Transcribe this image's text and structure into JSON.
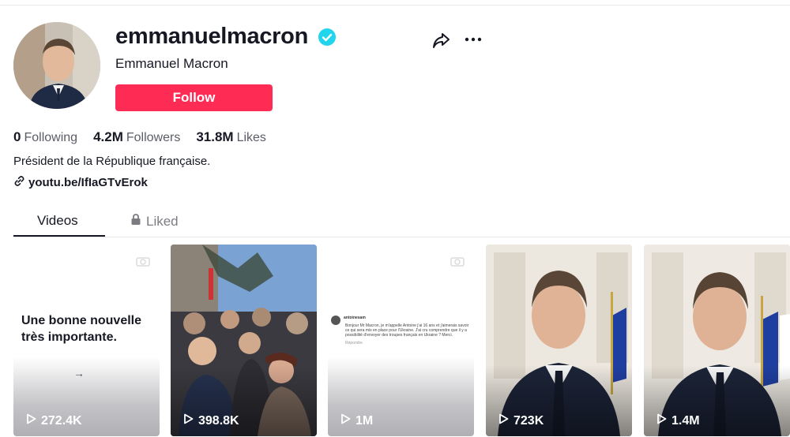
{
  "profile": {
    "username": "emmanuelmacron",
    "nickname": "Emmanuel Macron",
    "follow_label": "Follow",
    "stats": [
      {
        "value": "0",
        "label": "Following"
      },
      {
        "value": "4.2M",
        "label": "Followers"
      },
      {
        "value": "31.8M",
        "label": "Likes"
      }
    ],
    "bio": "Président de la République française.",
    "link": "youtu.be/IfIaGTvErok"
  },
  "tabs": [
    {
      "label": "Videos"
    },
    {
      "label": "Liked"
    }
  ],
  "videos": [
    {
      "views": "272.4K",
      "caption": "Une bonne nouvelle très importante.",
      "arrow": "→"
    },
    {
      "views": "398.8K"
    },
    {
      "views": "1M",
      "handle": "antoinesam",
      "message": "Bonjour Mr Macron, je m'appelle Antoine j'ai 16 ans et j'aimerais savoir ce qui sera mis en place pour l'Ukraine. J'ai cru comprendre que il y a possibilité d'envoyer des troupes français en Ukraine ? Merci.",
      "reply": "Répondre"
    },
    {
      "views": "723K"
    },
    {
      "views": "1.4M"
    }
  ],
  "colors": {
    "follow": "#fe2c55",
    "verified": "#20d5ec",
    "text": "#161823",
    "muted": "#5b5d66"
  },
  "icons": [
    "verified-badge-icon",
    "share-icon",
    "more-icon",
    "link-icon",
    "lock-icon",
    "play-icon"
  ]
}
